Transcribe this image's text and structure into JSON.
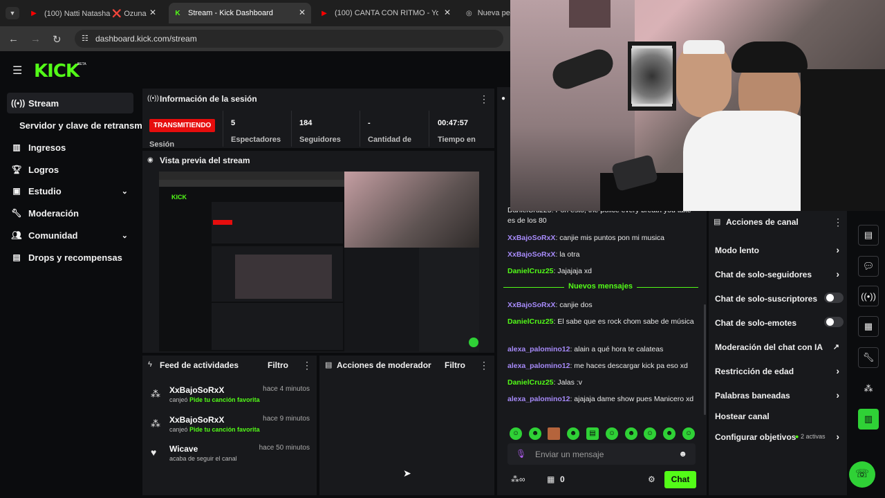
{
  "browser": {
    "tabs": [
      {
        "label": "(100) Natti Natasha ❌ Ozuna",
        "icon": "youtube-icon"
      },
      {
        "label": "Stream - Kick Dashboard",
        "icon": "kick-icon"
      },
      {
        "label": "(100) CANTA CON RITMO - You",
        "icon": "youtube-icon"
      },
      {
        "label": "Nueva pe",
        "icon": "chrome-icon"
      }
    ],
    "url": "dashboard.kick.com/stream"
  },
  "app": {
    "logo": "KICK",
    "beta": "BETA"
  },
  "sidebar": {
    "items": [
      {
        "label": "Stream",
        "icon": "broadcast-icon"
      },
      {
        "label": "Servidor y clave de retransm",
        "icon": ""
      },
      {
        "label": "Ingresos",
        "icon": "chart-icon"
      },
      {
        "label": "Logros",
        "icon": "trophy-icon"
      },
      {
        "label": "Estudio",
        "icon": "video-icon"
      },
      {
        "label": "Moderación",
        "icon": "wrench-icon"
      },
      {
        "label": "Comunidad",
        "icon": "people-icon"
      },
      {
        "label": "Drops y recompensas",
        "icon": "gift-icon"
      }
    ]
  },
  "session": {
    "title": "Información de la sesión",
    "status": "TRANSMITIENDO",
    "status_label": "Sesión",
    "stats": [
      {
        "value": "5",
        "label": "Espectadores"
      },
      {
        "value": "184",
        "label": "Seguidores"
      },
      {
        "value": "-",
        "label": "Cantidad de"
      },
      {
        "value": "00:47:57",
        "label": "Tiempo en"
      }
    ]
  },
  "preview": {
    "title": "Vista previa del stream"
  },
  "feed": {
    "title": "Feed de actividades",
    "filter": "Filtro",
    "items": [
      {
        "user": "XxBajoSoRxX",
        "time": "hace 4 minutos",
        "action": "canjeó",
        "reward": "Pide tu canción favorita"
      },
      {
        "user": "XxBajoSoRxX",
        "time": "hace 9 minutos",
        "action": "canjeó",
        "reward": "Pide tu canción favorita"
      },
      {
        "user": "Wicave",
        "time": "hace 50 minutos",
        "action": "acaba de seguir el canal",
        "reward": ""
      }
    ]
  },
  "modactions": {
    "title": "Acciones de moderador",
    "filter": "Filtro"
  },
  "chat": {
    "partial": "DanielCruz25: Pon esto, the police every breath you take es de los 80",
    "messages_before": [
      {
        "user": "XxBajoSoRxX",
        "text": ": canjie mis puntos pon mi musica",
        "color": "#a78bfa"
      },
      {
        "user": "XxBajoSoRxX",
        "text": ": la otra",
        "color": "#a78bfa"
      },
      {
        "user": "DanielCruz25",
        "text": ": Jajajaja xd",
        "color": "#53fc18"
      }
    ],
    "divider": "Nuevos mensajes",
    "messages_after": [
      {
        "user": "XxBajoSoRxX",
        "text": ": canjie dos",
        "color": "#a78bfa"
      },
      {
        "user": "DanielCruz25",
        "text": ": El sabe que es rock chom sabe de música",
        "color": "#53fc18"
      },
      {
        "user": "alexa_palomino12",
        "text": ": alain a qué hora te calateas",
        "color": "#a78bfa"
      },
      {
        "user": "alexa_palomino12",
        "text": ": me haces descargar kick pa eso xd",
        "color": "#a78bfa"
      },
      {
        "user": "DanielCruz25",
        "text": ": Jalas :v",
        "color": "#53fc18"
      },
      {
        "user": "alexa_palomino12",
        "text": ": ajajaja dame show pues Manicero xd",
        "color": "#a78bfa"
      }
    ],
    "placeholder": "Enviar un mensaje",
    "points": "0",
    "send": "Chat"
  },
  "channel_actions": {
    "title": "Acciones de canal",
    "rows": [
      {
        "label": "Modo lento",
        "kind": "chevron"
      },
      {
        "label": "Chat de solo-seguidores",
        "kind": "chevron"
      },
      {
        "label": "Chat de solo-suscriptores",
        "kind": "toggle"
      },
      {
        "label": "Chat de solo-emotes",
        "kind": "toggle"
      },
      {
        "label": "Moderación del chat con IA",
        "kind": "external"
      },
      {
        "label": "Restricción de edad",
        "kind": "chevron"
      },
      {
        "label": "Palabras baneadas",
        "kind": "chevron"
      },
      {
        "label": "Hostear canal",
        "kind": "none"
      },
      {
        "label": "Configurar objetivos",
        "kind": "chevron"
      }
    ],
    "goals_badge": "2 activas"
  }
}
